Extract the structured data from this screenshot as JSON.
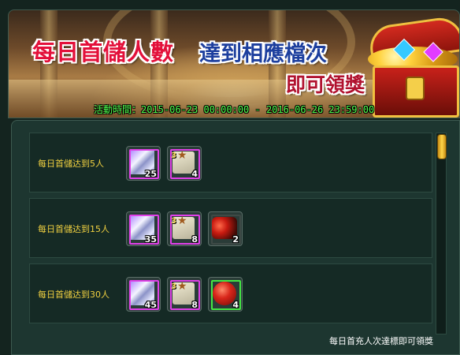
{
  "banner": {
    "title_part1": "每日首儲人數",
    "title_part2": "達到相應檔次",
    "title_part3": "即可領獎",
    "period": "活動時間：2015-06-23 00:00:00 - 2016-06-26 23:59:00"
  },
  "rewards": [
    {
      "label": "每日首儲达到5人",
      "items": [
        {
          "icon": "crystal-icon",
          "quantity": "25",
          "rarity": "purple"
        },
        {
          "icon": "scroll-icon",
          "quantity": "4",
          "rarity": "purple",
          "level": "3"
        }
      ]
    },
    {
      "label": "每日首儲达到15人",
      "items": [
        {
          "icon": "crystal-icon",
          "quantity": "35",
          "rarity": "purple"
        },
        {
          "icon": "scroll-icon",
          "quantity": "8",
          "rarity": "purple",
          "level": "3"
        },
        {
          "icon": "red-orb-icon",
          "quantity": "2",
          "rarity": "none"
        }
      ]
    },
    {
      "label": "每日首儲达到30人",
      "items": [
        {
          "icon": "crystal-icon",
          "quantity": "45",
          "rarity": "purple"
        },
        {
          "icon": "scroll-icon",
          "quantity": "8",
          "rarity": "purple",
          "level": "3"
        },
        {
          "icon": "red-orb-icon",
          "quantity": "4",
          "rarity": "green"
        }
      ]
    }
  ],
  "footer": {
    "note": "每日首充人次達標即可領獎"
  },
  "colors": {
    "label_gold": "#f0d040",
    "purple_frame": "#e040e8",
    "green_frame": "#44e644",
    "period_green": "#4dff4d"
  }
}
